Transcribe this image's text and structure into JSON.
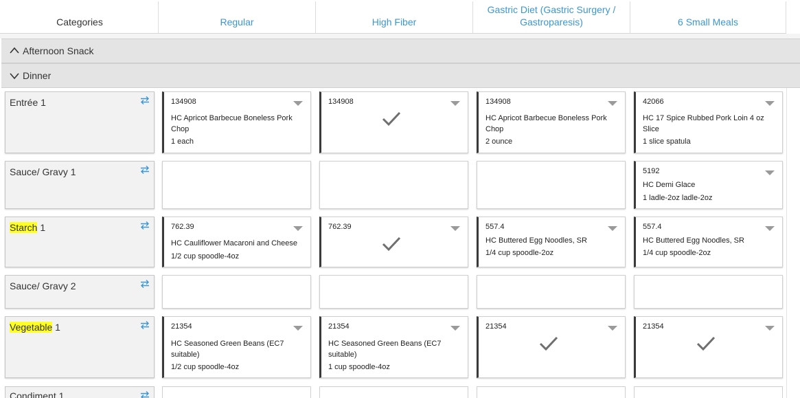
{
  "header": {
    "categories_label": "Categories",
    "diets": [
      "Regular",
      "High Fiber",
      "Gastric Diet (Gastric Surgery / Gastroparesis)",
      "6 Small Meals"
    ]
  },
  "groups": {
    "afternoon_snack": "Afternoon Snack",
    "dinner": "Dinner"
  },
  "rows": {
    "entree1": {
      "label": "Entrée 1",
      "c1": {
        "code": "134908",
        "name": "HC Apricot Barbecue Boneless Pork Chop",
        "portion": "1 each"
      },
      "c2": {
        "code": "134908"
      },
      "c3": {
        "code": "134908",
        "name": "HC Apricot Barbecue Boneless Pork Chop",
        "portion": "2 ounce"
      },
      "c4": {
        "code": "42066",
        "name": "HC 17 Spice Rubbed Pork Loin 4 oz Slice",
        "portion": "1 slice spatula"
      }
    },
    "sauce1": {
      "label": "Sauce/ Gravy 1",
      "c4": {
        "code": "5192",
        "name": "HC Demi Glace",
        "portion": "1 ladle-2oz ladle-2oz"
      }
    },
    "starch1": {
      "label_hl": "Starch",
      "label_rest": " 1",
      "c1": {
        "code": "762.39",
        "name": "HC Cauliflower Macaroni and Cheese",
        "portion": "1/2 cup spoodle-4oz"
      },
      "c2": {
        "code": "762.39"
      },
      "c3": {
        "code": "557.4",
        "name": "HC Buttered Egg Noodles, SR",
        "portion": "1/4 cup spoodle-2oz"
      },
      "c4": {
        "code": "557.4",
        "name": "HC Buttered Egg Noodles, SR",
        "portion": "1/4 cup spoodle-2oz"
      }
    },
    "sauce2": {
      "label": "Sauce/ Gravy 2"
    },
    "veg1": {
      "label_hl": "Vegetable",
      "label_rest": " 1",
      "c1": {
        "code": "21354",
        "name": "HC Seasoned Green Beans (EC7 suitable)",
        "portion": "1/2 cup spoodle-4oz"
      },
      "c2": {
        "code": "21354",
        "name": "HC Seasoned Green Beans (EC7 suitable)",
        "portion": "1 cup spoodle-4oz"
      },
      "c3": {
        "code": "21354"
      },
      "c4": {
        "code": "21354"
      }
    },
    "condiment1": {
      "label": "Condiment 1"
    }
  },
  "icons": {
    "swap": "swap-arrows-icon",
    "dropdown": "caret-down-icon",
    "check": "checkmark-icon",
    "chevron_up": "chevron-up-icon",
    "chevron_down": "chevron-down-icon"
  },
  "colors": {
    "accent": "#3a97d4",
    "highlight": "#ffff21",
    "group_bg": "#e4e4e4",
    "category_bg": "#f2f2f2"
  }
}
